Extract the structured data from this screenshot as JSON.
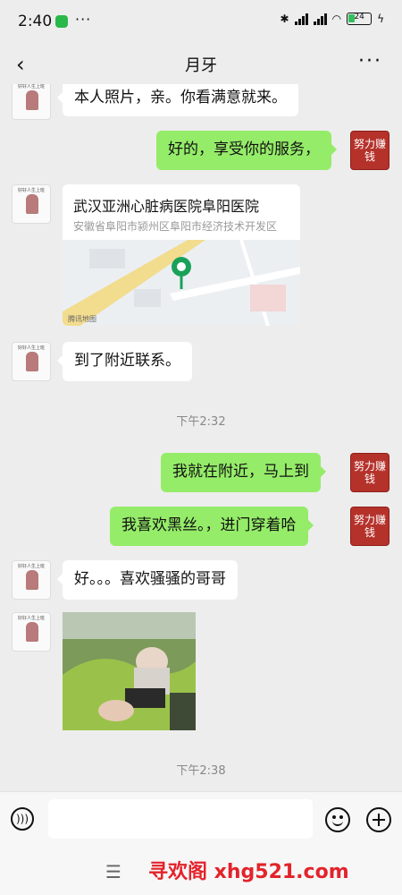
{
  "status": {
    "time": "2:40",
    "battery": "24"
  },
  "header": {
    "back_icon": "chevron-left-icon",
    "title": "月牙",
    "more_icon": "more-icon"
  },
  "avatars": {
    "contact_caption": "好好人生上班",
    "self_text": "努力赚钱"
  },
  "messages": [
    {
      "side": "in",
      "text": "本人照片，亲。你看满意就来。"
    },
    {
      "side": "out",
      "text": "好的，享受你的服务，"
    },
    {
      "side": "in",
      "type": "location",
      "name": "武汉亚洲心脏病医院阜阳医院",
      "address": "安徽省阜阳市颍州区阜阳市经济技术开发区",
      "map_credit": "腾讯地图"
    },
    {
      "side": "in",
      "text": "到了附近联系。"
    },
    {
      "type": "time",
      "text": "下午2:32"
    },
    {
      "side": "out",
      "text": "我就在附近，马上到"
    },
    {
      "side": "out",
      "text": "我喜欢黑丝。，进门穿着哈"
    },
    {
      "side": "in",
      "text": "好。。。喜欢骚骚的哥哥"
    },
    {
      "side": "in",
      "type": "image"
    },
    {
      "type": "time",
      "text": "下午2:38"
    }
  ],
  "inputbar": {
    "voice_icon": "voice-icon",
    "emoji_icon": "emoji-icon",
    "plus_icon": "plus-icon"
  },
  "bottom": {
    "menu_icon": "menu-icon",
    "watermark": "寻欢阁 xhg521.com"
  },
  "colors": {
    "background": "#ededed",
    "bubble_out": "#95ec69",
    "bubble_in": "#ffffff",
    "watermark": "#e3232b"
  }
}
